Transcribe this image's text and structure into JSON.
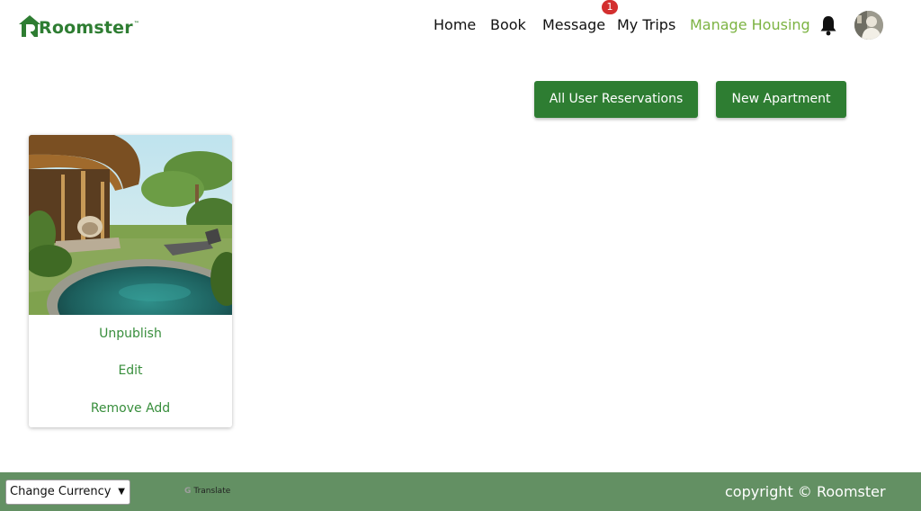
{
  "brand": {
    "name": "Roomster",
    "trademark": "™",
    "color": "#2e7d32"
  },
  "nav": {
    "home": "Home",
    "book": "Book",
    "message": "Message",
    "message_badge": "1",
    "my_trips": "My Trips",
    "manage_housing": "Manage Housing",
    "active_color": "#7cb342",
    "bell_icon": "bell-icon",
    "avatar_icon": "user-avatar"
  },
  "actions": {
    "all_reservations": "All User Reservations",
    "new_apartment": "New Apartment",
    "button_color": "#2e7d32"
  },
  "listing": {
    "photo": "tropical-villa-with-pool",
    "unpublish": "Unpublish",
    "edit": "Edit",
    "remove": "Remove Add",
    "action_color": "#388e3c"
  },
  "footer": {
    "currency_select": "Change Currency",
    "translate_label": "Translate",
    "copyright": "copyright © Roomster",
    "background": "#639063"
  }
}
